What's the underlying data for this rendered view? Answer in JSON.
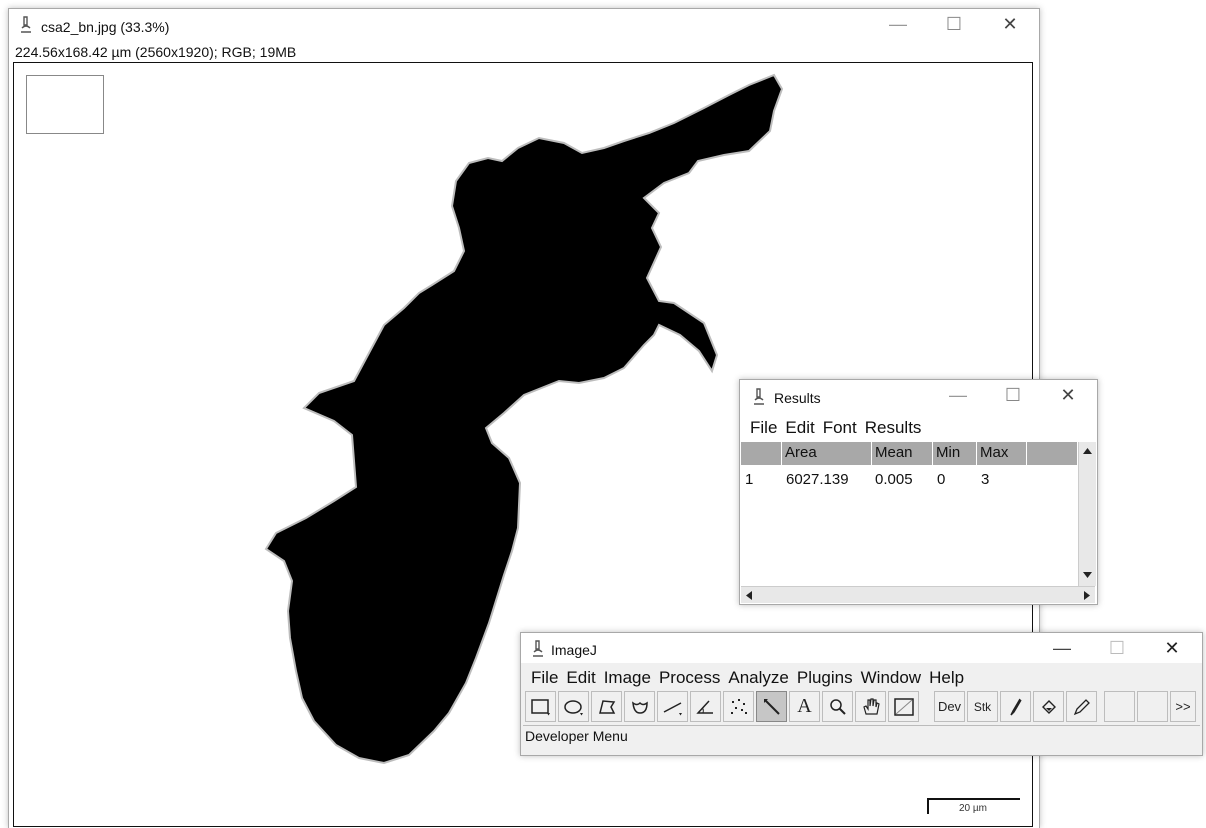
{
  "image_window": {
    "title": "csa2_bn.jpg (33.3%)",
    "info": "224.56x168.42 µm (2560x1920); RGB; 19MB",
    "scale_bar_label": "20 µm",
    "controls": {
      "minimize": "—",
      "maximize": "☐",
      "close": "✕"
    }
  },
  "results_window": {
    "title": "Results",
    "menu": [
      "File",
      "Edit",
      "Font",
      "Results"
    ],
    "columns": [
      "",
      "Area",
      "Mean",
      "Min",
      "Max"
    ],
    "rows": [
      [
        "1",
        "6027.139",
        "0.005",
        "0",
        "3"
      ]
    ],
    "controls": {
      "minimize": "—",
      "maximize": "☐",
      "close": "✕"
    }
  },
  "imagej_window": {
    "title": "ImageJ",
    "menu": [
      "File",
      "Edit",
      "Image",
      "Process",
      "Analyze",
      "Plugins",
      "Window",
      "Help"
    ],
    "status": "Developer Menu",
    "tools": {
      "dev": "Dev",
      "stk": "Stk",
      "text": "A",
      "more": ">>"
    },
    "selected_tool": "wand-tool",
    "controls": {
      "minimize": "—",
      "maximize": "☐",
      "close": "✕"
    }
  }
}
